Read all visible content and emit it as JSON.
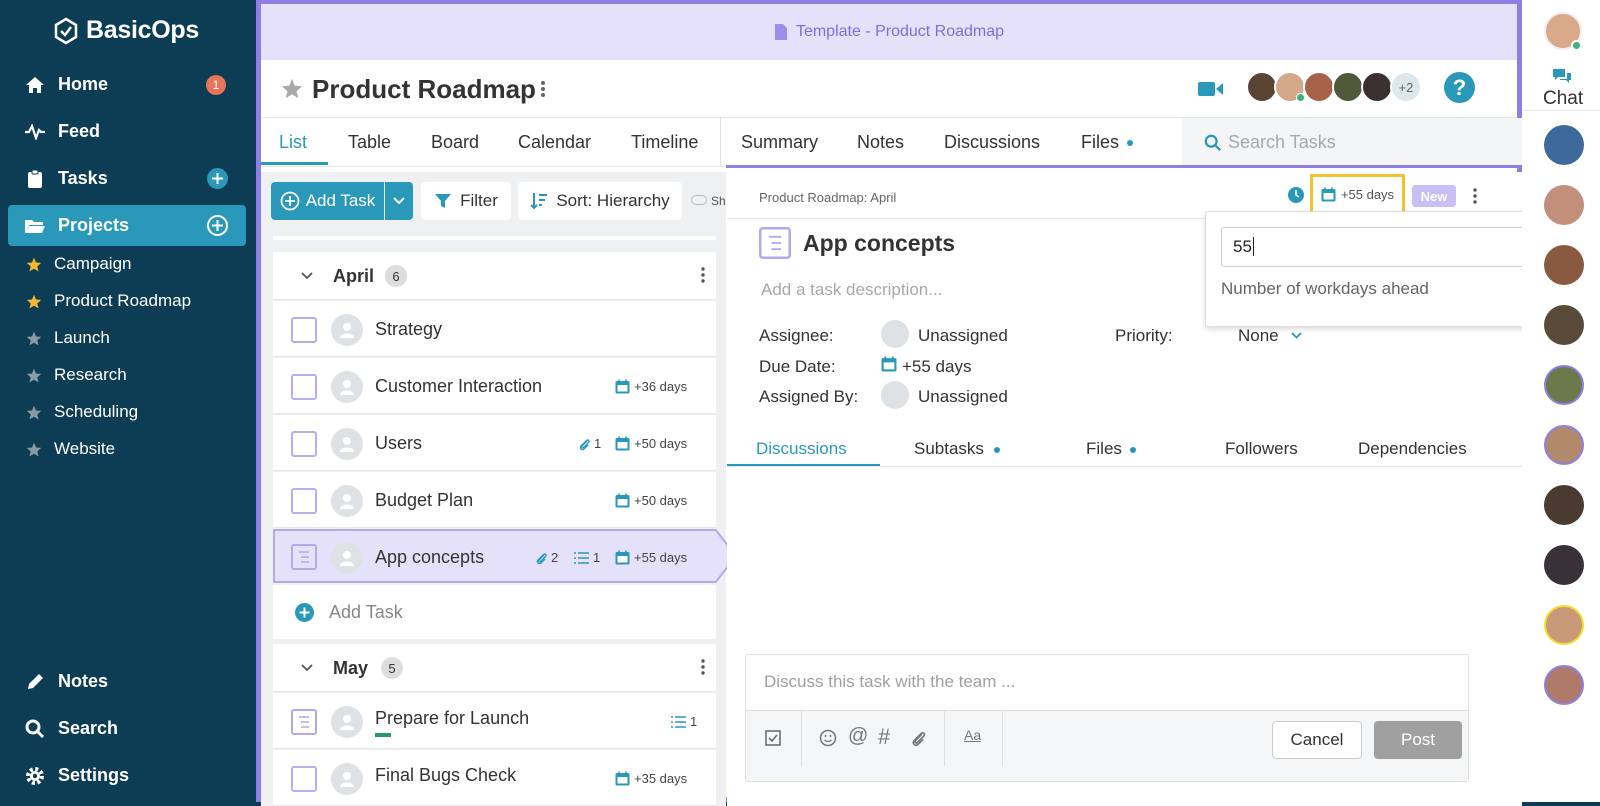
{
  "sidebar": {
    "brand": "BasicOps",
    "nav": [
      {
        "label": "Home",
        "icon": "home-icon",
        "badge": "1"
      },
      {
        "label": "Feed",
        "icon": "pulse-icon"
      },
      {
        "label": "Tasks",
        "icon": "clipboard-icon"
      },
      {
        "label": "Projects",
        "icon": "folder-icon"
      }
    ],
    "projects": [
      {
        "label": "Campaign",
        "starred": true
      },
      {
        "label": "Product Roadmap",
        "starred": true
      },
      {
        "label": "Launch",
        "starred": false
      },
      {
        "label": "Research",
        "starred": false
      },
      {
        "label": "Scheduling",
        "starred": false
      },
      {
        "label": "Website",
        "starred": false
      }
    ],
    "bottom": [
      {
        "label": "Notes",
        "icon": "pencil-icon"
      },
      {
        "label": "Search",
        "icon": "search-icon"
      },
      {
        "label": "Settings",
        "icon": "gear-icon"
      }
    ]
  },
  "template_bar": {
    "label": "Template - Product Roadmap"
  },
  "header": {
    "title": "Product Roadmap",
    "members_extra": "+2"
  },
  "tabs": {
    "left": [
      "List",
      "Table",
      "Board",
      "Calendar",
      "Timeline"
    ],
    "right": [
      "Summary",
      "Notes",
      "Discussions",
      "Files"
    ],
    "search_placeholder": "Search Tasks"
  },
  "toolbar": {
    "add_task": "Add Task",
    "filter": "Filter",
    "sort": "Sort: Hierarchy",
    "show": "Sh"
  },
  "groups": [
    {
      "name": "April",
      "count": "6"
    },
    {
      "name": "May",
      "count": "5"
    }
  ],
  "tasks": [
    {
      "title": "Strategy"
    },
    {
      "title": "Customer Interaction",
      "due": "+36 days"
    },
    {
      "title": "Users",
      "attachments": "1",
      "due": "+50 days"
    },
    {
      "title": "Budget Plan",
      "due": "+50 days"
    },
    {
      "title": "App concepts",
      "attachments": "2",
      "subtasks": "1",
      "due": "+55 days"
    },
    {
      "title": "Prepare for Launch",
      "subtasks": "1"
    },
    {
      "title": "Final Bugs Check",
      "due": "+35 days"
    }
  ],
  "add_task_row": "Add Task",
  "detail": {
    "breadcrumb": "Product Roadmap: April",
    "due_chip": "+55 days",
    "new_badge": "New",
    "title": "App concepts",
    "description_placeholder": "Add a task description...",
    "assignee_label": "Assignee:",
    "assignee_value": "Unassigned",
    "due_label": "Due Date:",
    "due_value": "+55 days",
    "assigned_by_label": "Assigned By:",
    "assigned_by_value": "Unassigned",
    "priority_label": "Priority:",
    "priority_value": "None",
    "tabs": [
      "Discussions",
      "Subtasks",
      "Files",
      "Followers",
      "Dependencies"
    ],
    "comment_placeholder": "Discuss this task with the team ...",
    "cancel": "Cancel",
    "post": "Post"
  },
  "popover": {
    "value": "55",
    "hint": "Number of workdays ahead"
  },
  "rightbar": {
    "chat_label": "Chat"
  },
  "colors": {
    "sidebar": "#0c3d54",
    "accent": "#2a98b8",
    "purple": "#8d7fe6",
    "badge": "#e5765a"
  }
}
